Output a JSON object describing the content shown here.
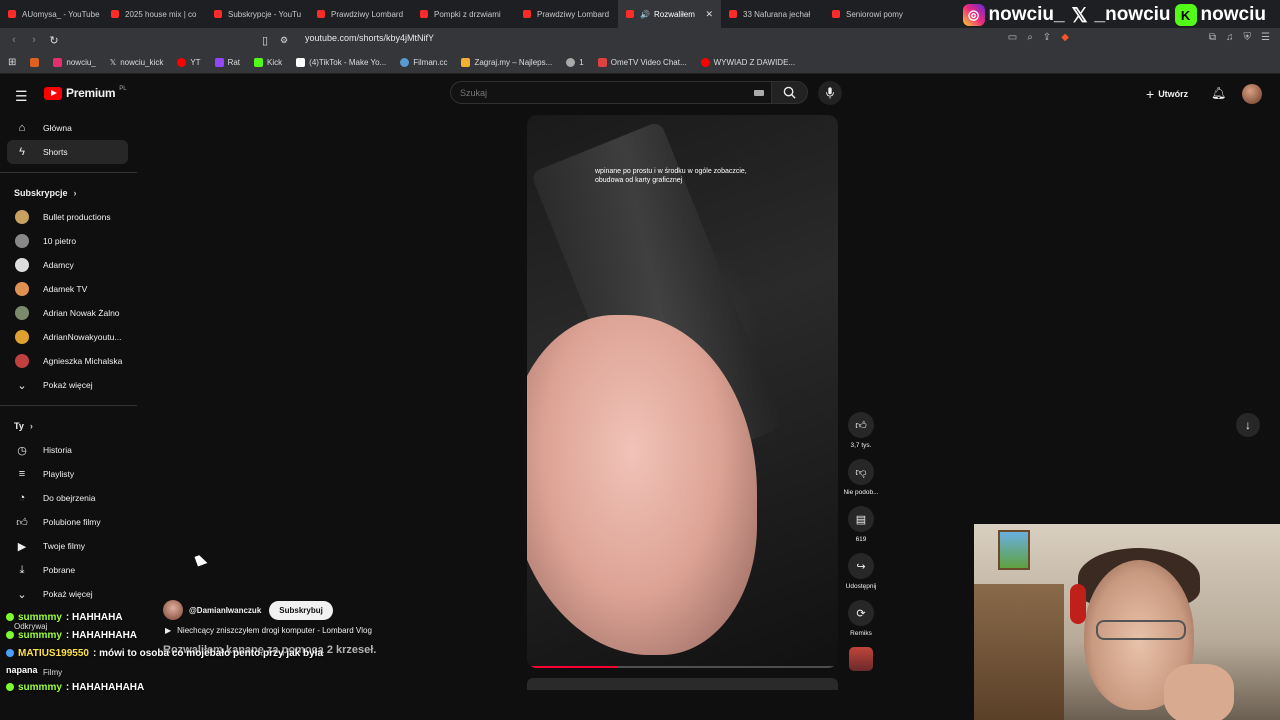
{
  "browser": {
    "tabs": [
      {
        "label": "AUomysa_ - YouTube",
        "active": false
      },
      {
        "label": "2025 house mix | co",
        "active": false
      },
      {
        "label": "Subskrypcje - YouTu",
        "active": false
      },
      {
        "label": "Prawdziwy Lombard",
        "active": false
      },
      {
        "label": "Pompki z drzwiami",
        "active": false
      },
      {
        "label": "Prawdziwy Lombard",
        "active": false
      },
      {
        "label": "Rozwaliłem",
        "active": true
      },
      {
        "label": "33 Nafurana jechał",
        "active": false
      },
      {
        "label": "Seniorowi pomy",
        "active": false
      }
    ],
    "url": "youtube.com/shorts/kby4jMtNifY",
    "bookmarks": [
      {
        "label": "nowciu_",
        "color": "#e1306c"
      },
      {
        "label": "nowciu_kick",
        "color": "#ffffff"
      },
      {
        "label": "YT",
        "color": "#ff0000"
      },
      {
        "label": "Rat",
        "color": "#9146ff"
      },
      {
        "label": "Kick",
        "color": "#53fc18"
      },
      {
        "label": "(4)TikTok - Make Yo...",
        "color": "#ffffff"
      },
      {
        "label": "Filman.cc",
        "color": "#5a9ad0"
      },
      {
        "label": "Zagraj.my – Najleps...",
        "color": "#f0b030"
      },
      {
        "label": "1",
        "color": "#aaaaaa"
      },
      {
        "label": "OmeTV Video Chat...",
        "color": "#e04040"
      },
      {
        "label": "WYWIAD Z DAWIDE...",
        "color": "#ff0000"
      }
    ]
  },
  "socials": {
    "instagram": "nowciu_",
    "x": "_nowciu",
    "kick": "nowciu"
  },
  "header": {
    "logo": "Premium",
    "logo_region": "PL",
    "search_placeholder": "Szukaj",
    "create_label": "Utwórz"
  },
  "sidebar": {
    "main": [
      {
        "label": "Główna",
        "icon": "home-icon"
      },
      {
        "label": "Shorts",
        "icon": "shorts-icon",
        "active": true
      }
    ],
    "subscriptions_title": "Subskrypcje",
    "subscriptions": [
      {
        "label": "Bullet productions",
        "color": "#c8a060"
      },
      {
        "label": "10 pietro",
        "color": "#888888"
      },
      {
        "label": "Adamcy",
        "color": "#dddddd"
      },
      {
        "label": "Adamek TV",
        "color": "#e09050"
      },
      {
        "label": "Adrian Nowak Żalno",
        "color": "#7a8a6a"
      },
      {
        "label": "AdrianNowakyoutu...",
        "color": "#e0a030"
      },
      {
        "label": "Agnieszka Michalska",
        "color": "#c04040"
      }
    ],
    "show_more": "Pokaż więcej",
    "you_title": "Ty",
    "you": [
      {
        "label": "Historia",
        "icon": "history-icon"
      },
      {
        "label": "Playlisty",
        "icon": "playlist-icon"
      },
      {
        "label": "Do obejrzenia",
        "icon": "watch-later-icon"
      },
      {
        "label": "Polubione filmy",
        "icon": "like-icon"
      },
      {
        "label": "Twoje filmy",
        "icon": "your-videos-icon"
      },
      {
        "label": "Pobrane",
        "icon": "download-icon"
      }
    ],
    "show_more_2": "Pokaż więcej",
    "explore_partial": "Odkrywaj",
    "films_partial": "Filmy"
  },
  "short": {
    "caption": "wpinane po prostu i w środku w ogóle zobaczcie, obudowa od karty graficznej",
    "progress": 0.29,
    "channel": "@DamianIwanczuk",
    "subscribe_label": "Subskrybuj",
    "related_video": "Niechcący zniszczyłem drogi komputer - Lombard Vlog",
    "title_overlay": "Rozwaliłem kanapę za pomocą 2 krzeseł."
  },
  "actions": {
    "likes": "3,7 tys.",
    "dislike": "Nie podob...",
    "comments": "619",
    "share": "Udostępnij",
    "remix": "Remiks"
  },
  "chat": [
    {
      "user": "summmy",
      "msg": ": HAHHAHA"
    },
    {
      "user": "summmy",
      "msg": ": HAHAHHAHA"
    },
    {
      "user": "MATIUS199550",
      "msg": ": mówi to osoba co mojebało pento przy jak była"
    },
    {
      "user": "",
      "msg": "napana"
    },
    {
      "user": "summmy",
      "msg": ": HAHAHAHAHA"
    }
  ]
}
